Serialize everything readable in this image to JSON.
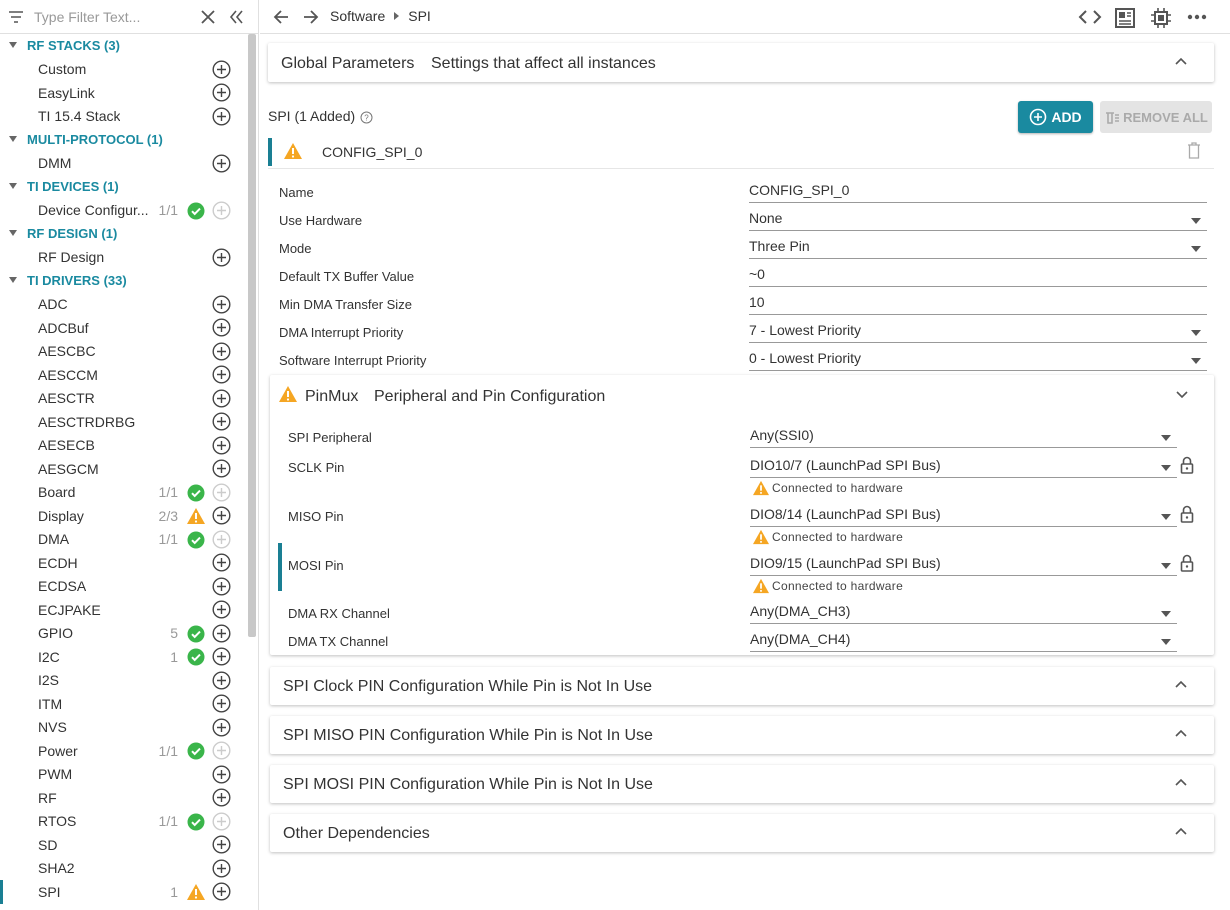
{
  "sidebar": {
    "filter_placeholder": "Type Filter Text...",
    "groups": [
      {
        "label": "RF STACKS (3)",
        "items": [
          {
            "label": "Custom"
          },
          {
            "label": "EasyLink"
          },
          {
            "label": "TI 15.4 Stack"
          }
        ]
      },
      {
        "label": "MULTI-PROTOCOL (1)",
        "items": [
          {
            "label": "DMM"
          }
        ]
      },
      {
        "label": "TI DEVICES (1)",
        "items": [
          {
            "label": "Device Configur...",
            "count": "1/1",
            "status": "ok",
            "add_disabled": true
          }
        ]
      },
      {
        "label": "RF DESIGN (1)",
        "items": [
          {
            "label": "RF Design"
          }
        ]
      },
      {
        "label": "TI DRIVERS (33)",
        "items": [
          {
            "label": "ADC"
          },
          {
            "label": "ADCBuf"
          },
          {
            "label": "AESCBC"
          },
          {
            "label": "AESCCM"
          },
          {
            "label": "AESCTR"
          },
          {
            "label": "AESCTRDRBG"
          },
          {
            "label": "AESECB"
          },
          {
            "label": "AESGCM"
          },
          {
            "label": "Board",
            "count": "1/1",
            "status": "ok",
            "add_disabled": true
          },
          {
            "label": "Display",
            "count": "2/3",
            "status": "warn"
          },
          {
            "label": "DMA",
            "count": "1/1",
            "status": "ok",
            "add_disabled": true
          },
          {
            "label": "ECDH"
          },
          {
            "label": "ECDSA"
          },
          {
            "label": "ECJPAKE"
          },
          {
            "label": "GPIO",
            "count": "5",
            "status": "ok"
          },
          {
            "label": "I2C",
            "count": "1",
            "status": "ok"
          },
          {
            "label": "I2S"
          },
          {
            "label": "ITM"
          },
          {
            "label": "NVS"
          },
          {
            "label": "Power",
            "count": "1/1",
            "status": "ok",
            "add_disabled": true
          },
          {
            "label": "PWM"
          },
          {
            "label": "RF"
          },
          {
            "label": "RTOS",
            "count": "1/1",
            "status": "ok",
            "add_disabled": true
          },
          {
            "label": "SD"
          },
          {
            "label": "SHA2"
          },
          {
            "label": "SPI",
            "count": "1",
            "status": "warn",
            "selected": true
          }
        ]
      }
    ]
  },
  "topbar": {
    "crumb_parent": "Software",
    "crumb_current": "SPI"
  },
  "global_params": {
    "title": "Global Parameters",
    "subtitle": "Settings that affect all instances"
  },
  "spi": {
    "title": "SPI (1 Added)",
    "add_label": "ADD",
    "remove_all_label": "REMOVE ALL",
    "instance_name": "CONFIG_SPI_0",
    "params": [
      {
        "key": "Name",
        "value": "CONFIG_SPI_0",
        "dropdown": false
      },
      {
        "key": "Use Hardware",
        "value": "None",
        "dropdown": true
      },
      {
        "key": "Mode",
        "value": "Three Pin",
        "dropdown": true
      },
      {
        "key": "Default TX Buffer Value",
        "value": "~0",
        "dropdown": false
      },
      {
        "key": "Min DMA Transfer Size",
        "value": "10",
        "dropdown": false
      },
      {
        "key": "DMA Interrupt Priority",
        "value": "7 - Lowest Priority",
        "dropdown": true
      },
      {
        "key": "Software Interrupt Priority",
        "value": "0 - Lowest Priority",
        "dropdown": true
      }
    ]
  },
  "pinmux": {
    "title": "PinMux",
    "subtitle": "Peripheral and Pin Configuration",
    "rows": [
      {
        "key": "SPI Peripheral",
        "value": "Any(SSI0)"
      },
      {
        "key": "SCLK Pin",
        "value": "DIO10/7 (LaunchPad SPI Bus)",
        "note": "Connected to hardware",
        "locked": true
      },
      {
        "key": "MISO Pin",
        "value": "DIO8/14 (LaunchPad SPI Bus)",
        "note": "Connected to hardware",
        "locked": true
      },
      {
        "key": "MOSI Pin",
        "value": "DIO9/15 (LaunchPad SPI Bus)",
        "note": "Connected to hardware",
        "locked": true,
        "marked": true
      },
      {
        "key": "DMA RX Channel",
        "value": "Any(DMA_CH3)"
      },
      {
        "key": "DMA TX Channel",
        "value": "Any(DMA_CH4)"
      }
    ]
  },
  "sections": [
    {
      "title": "SPI Clock PIN Configuration While Pin is Not In Use"
    },
    {
      "title": "SPI MISO PIN Configuration While Pin is Not In Use"
    },
    {
      "title": "SPI MOSI PIN Configuration While Pin is Not In Use"
    },
    {
      "title": "Other Dependencies"
    }
  ],
  "colors": {
    "accent": "#1a8aa0",
    "ok": "#3ab54a",
    "warn": "#f5a623"
  }
}
